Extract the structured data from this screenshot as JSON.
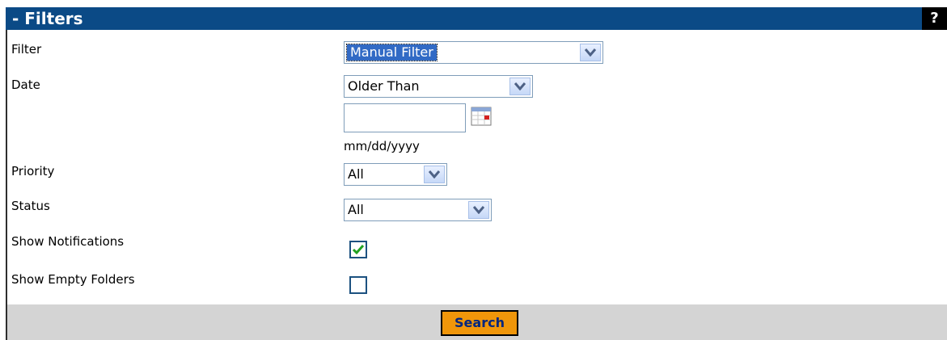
{
  "header": {
    "title": "- Filters",
    "help_label": "?"
  },
  "fields": {
    "filter": {
      "label": "Filter",
      "value": "Manual Filter"
    },
    "date": {
      "label": "Date",
      "mode": "Older Than",
      "input_value": "",
      "format_hint": "mm/dd/yyyy"
    },
    "priority": {
      "label": "Priority",
      "value": "All"
    },
    "status": {
      "label": "Status",
      "value": "All"
    },
    "show_notifications": {
      "label": "Show Notifications",
      "checked": true
    },
    "show_empty_folders": {
      "label": "Show Empty Folders",
      "checked": false
    }
  },
  "footer": {
    "search_label": "Search"
  },
  "colors": {
    "header_bg": "#0b4a86",
    "button_bg": "#f0960a",
    "footer_bg": "#d4d4d4",
    "check_green": "#21a121"
  },
  "icons": {
    "dropdown": "chevron-down-icon",
    "calendar": "calendar-icon",
    "check": "checkmark-icon"
  }
}
